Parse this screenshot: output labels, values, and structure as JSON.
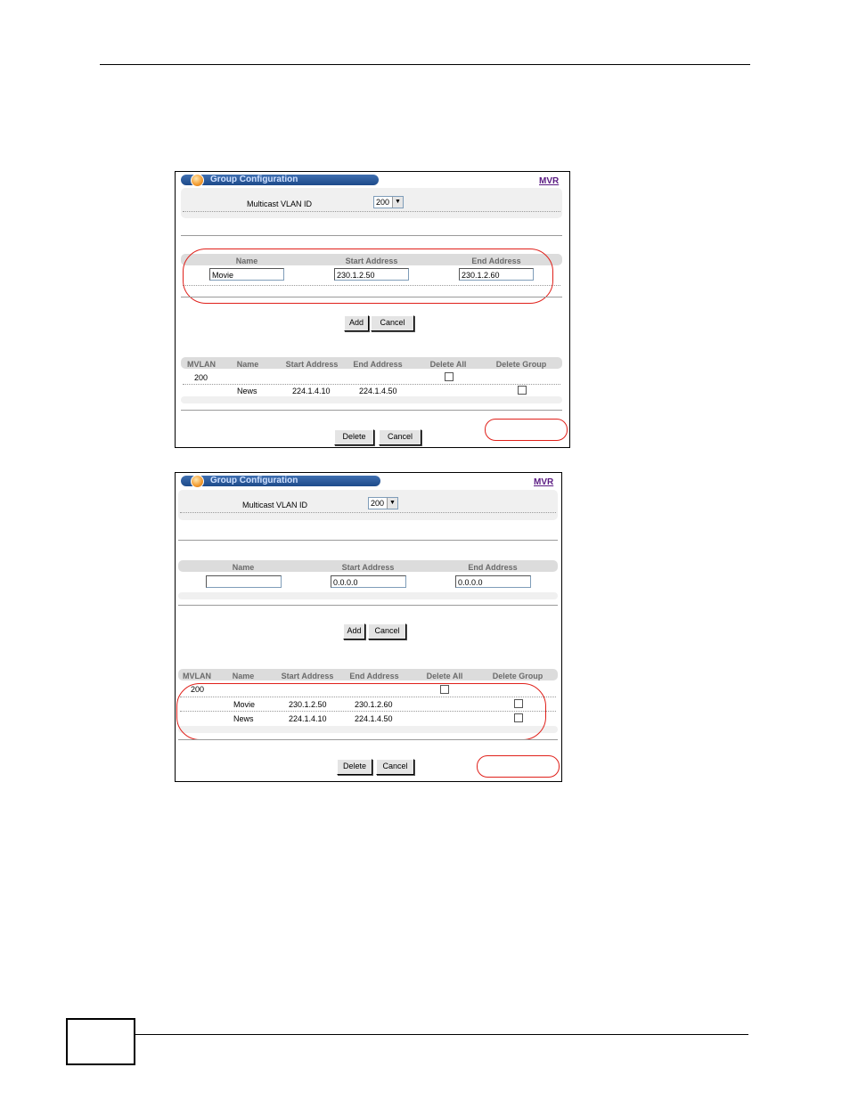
{
  "panel1": {
    "title": "Group Configuration",
    "link": "MVR",
    "vlan_label": "Multicast VLAN ID",
    "vlan_value": "200",
    "form": {
      "headers": [
        "Name",
        "Start Address",
        "End Address"
      ],
      "name_value": "Movie",
      "start_value": "230.1.2.50",
      "end_value": "230.1.2.60"
    },
    "buttons": {
      "add": "Add",
      "cancel": "Cancel",
      "delete": "Delete",
      "cancel2": "Cancel"
    },
    "table": {
      "headers": [
        "MVLAN",
        "Name",
        "Start Address",
        "End Address",
        "Delete All",
        "Delete Group"
      ],
      "mvlan": "200",
      "rows": [
        {
          "name": "News",
          "start": "224.1.4.10",
          "end": "224.1.4.50"
        }
      ]
    }
  },
  "panel2": {
    "title": "Group Configuration",
    "link": "MVR",
    "vlan_label": "Multicast VLAN ID",
    "vlan_value": "200",
    "form": {
      "headers": [
        "Name",
        "Start Address",
        "End Address"
      ],
      "name_value": "",
      "start_value": "0.0.0.0",
      "end_value": "0.0.0.0"
    },
    "buttons": {
      "add": "Add",
      "cancel": "Cancel",
      "delete": "Delete",
      "cancel2": "Cancel"
    },
    "table": {
      "headers": [
        "MVLAN",
        "Name",
        "Start Address",
        "End Address",
        "Delete All",
        "Delete Group"
      ],
      "mvlan": "200",
      "rows": [
        {
          "name": "Movie",
          "start": "230.1.2.50",
          "end": "230.1.2.60"
        },
        {
          "name": "News",
          "start": "224.1.4.10",
          "end": "224.1.4.50"
        }
      ]
    }
  },
  "colors": {
    "highlight_oval": "#e0201a",
    "title_bar": "#2a5a9a",
    "link": "#5a1a82"
  },
  "icons": [
    "orb-icon",
    "dropdown-arrow-icon"
  ]
}
